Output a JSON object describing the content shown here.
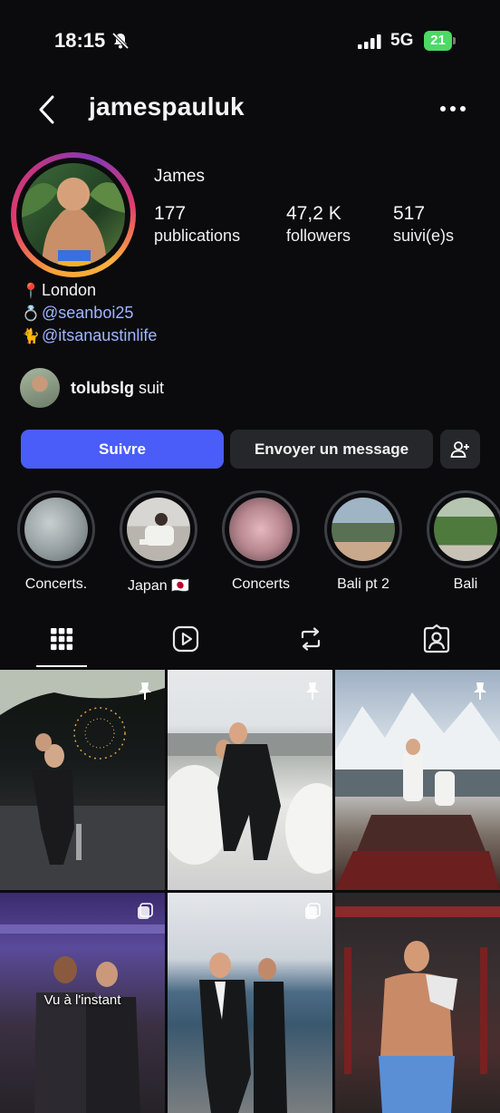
{
  "status_bar": {
    "time": "18:15",
    "network": "5G",
    "battery": "21"
  },
  "header": {
    "username": "jamespauluk"
  },
  "profile": {
    "display_name": "James",
    "stats": [
      {
        "value": "177",
        "label": "publications"
      },
      {
        "value": "47,2 K",
        "label": "followers"
      },
      {
        "value": "517",
        "label": "suivi(e)s"
      }
    ],
    "bio": [
      {
        "emoji": "📍",
        "text": "London",
        "is_link": false
      },
      {
        "emoji": "💍",
        "text": "@seanboi25",
        "is_link": true
      },
      {
        "emoji": "🐈",
        "text": "@itsanaustinlife",
        "is_link": true
      }
    ],
    "mutual": {
      "username": "tolubslg",
      "suffix": " suit"
    }
  },
  "actions": {
    "follow_label": "Suivre",
    "message_label": "Envoyer un message"
  },
  "highlights": [
    {
      "label": "Concerts."
    },
    {
      "label": "Japan 🇯🇵"
    },
    {
      "label": "Concerts"
    },
    {
      "label": "Bali pt 2"
    },
    {
      "label": "Bali"
    }
  ],
  "tabs": [
    {
      "icon": "grid-icon"
    },
    {
      "icon": "reels-icon"
    },
    {
      "icon": "reposts-icon"
    },
    {
      "icon": "tagged-icon"
    }
  ],
  "posts": [
    {
      "overlay_icon": "pin-icon",
      "overlay_text": ""
    },
    {
      "overlay_icon": "pin-icon",
      "overlay_text": ""
    },
    {
      "overlay_icon": "pin-icon",
      "overlay_text": ""
    },
    {
      "overlay_icon": "carousel-icon",
      "overlay_text": "Vu à l'instant"
    },
    {
      "overlay_icon": "carousel-icon",
      "overlay_text": ""
    },
    {
      "overlay_icon": "",
      "overlay_text": ""
    }
  ],
  "colors": {
    "background": "#0b0b0e",
    "follow_button": "#4a5df9",
    "secondary_button": "#26272b",
    "link": "#9fb6ff",
    "battery_fill": "#4cd964"
  }
}
